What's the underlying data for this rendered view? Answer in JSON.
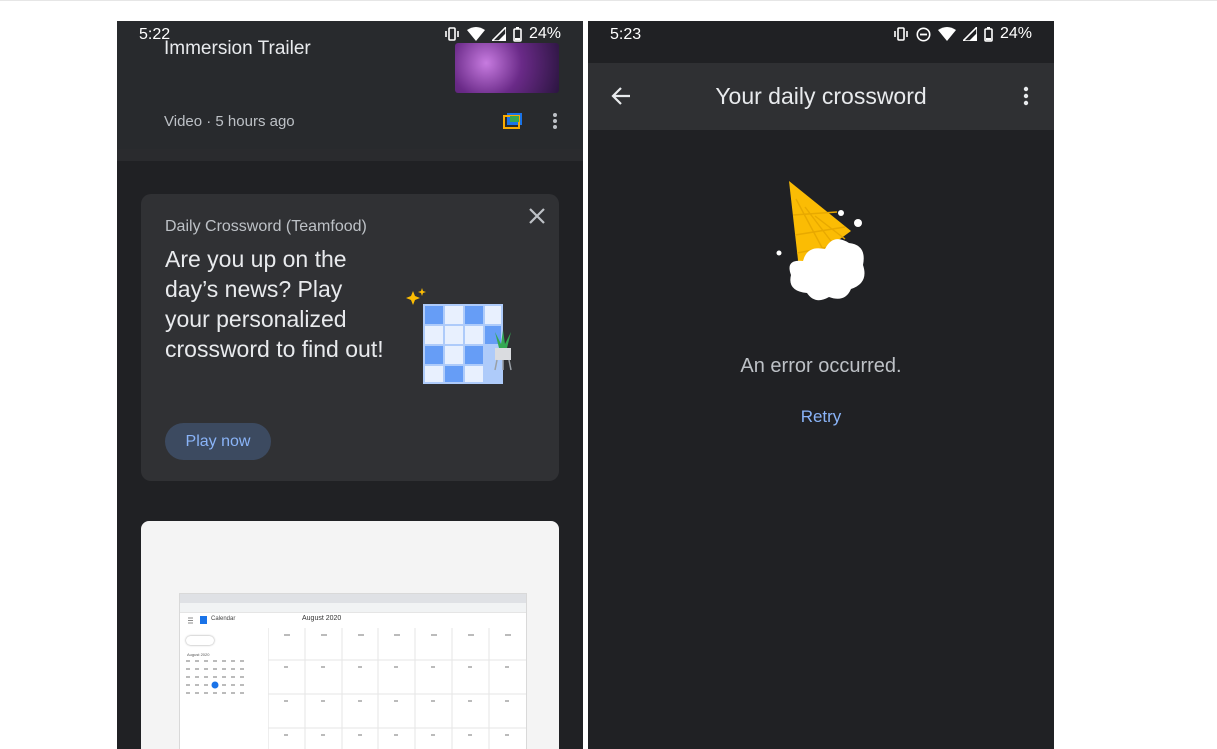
{
  "left_phone": {
    "status": {
      "time": "5:22",
      "battery": "24%",
      "icons": [
        "vibrate-icon",
        "wifi-icon",
        "signal-icon",
        "battery-icon"
      ]
    },
    "feed_item": {
      "title": "Immersion Trailer",
      "meta": "Video · 5 hours ago"
    },
    "crossword_card": {
      "source": "Daily Crossword (Teamfood)",
      "headline": "Are you up on the day’s news? Play your personalized crossword to find out!",
      "button": "Play now"
    },
    "preview_card": {
      "calendar_label": "Calendar",
      "month": "August 2020",
      "mini_month": "August 2020"
    }
  },
  "right_phone": {
    "status": {
      "time": "5:23",
      "battery": "24%",
      "icons": [
        "vibrate-icon",
        "do-not-disturb-icon",
        "wifi-icon",
        "signal-icon",
        "battery-icon"
      ]
    },
    "appbar": {
      "title": "Your daily crossword"
    },
    "error": {
      "message": "An error occurred.",
      "retry": "Retry"
    }
  },
  "colors": {
    "background": "#202124",
    "card": "#303134",
    "accent": "#8ab4f8",
    "text": "#e8eaed"
  }
}
